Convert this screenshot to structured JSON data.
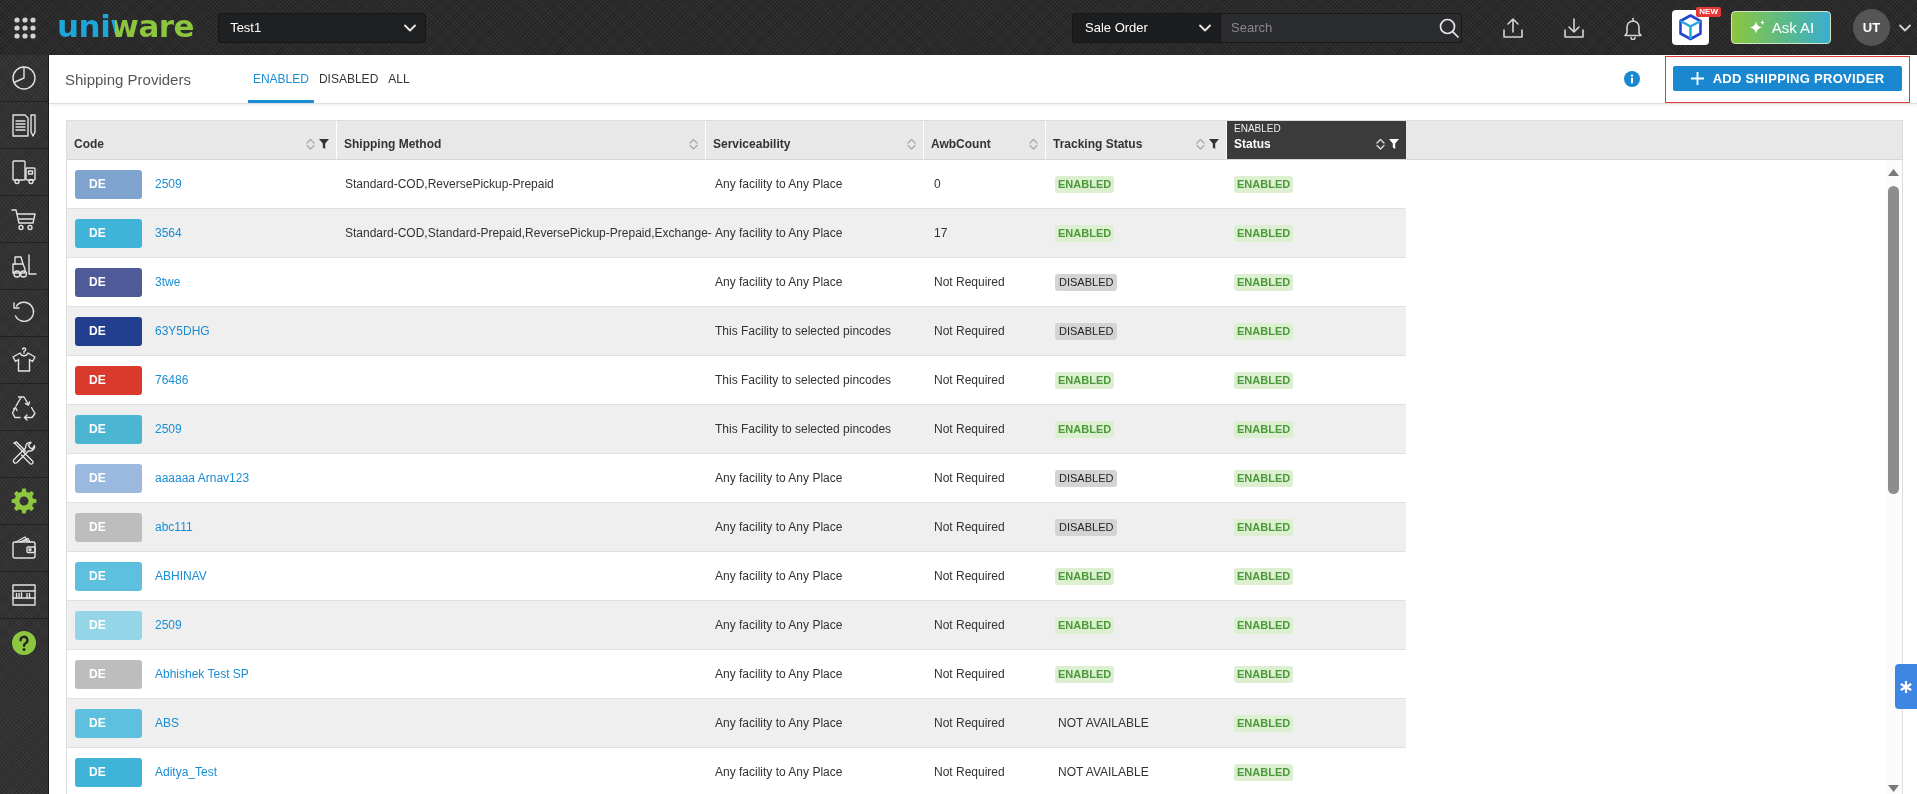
{
  "top_bar": {
    "logo": "uniware",
    "facility": "Test1",
    "search_type": "Sale Order",
    "search": {
      "placeholder": "Search"
    },
    "new_badge": "NEW",
    "ask_ai": "Ask AI",
    "avatar": "UT"
  },
  "sidebar": {
    "items": [
      {
        "selected": false
      },
      {
        "selected": false
      },
      {
        "selected": false
      },
      {
        "selected": false
      },
      {
        "selected": false
      },
      {
        "selected": false
      },
      {
        "selected": false
      },
      {
        "selected": false
      },
      {
        "selected": false
      },
      {
        "selected": true
      },
      {
        "selected": false
      },
      {
        "selected": false
      }
    ]
  },
  "header": {
    "title": "Shipping Providers",
    "tabs": [
      {
        "label": "ENABLED",
        "selected": true
      },
      {
        "label": "DISABLED",
        "selected": false
      },
      {
        "label": "ALL",
        "selected": false
      }
    ],
    "add_button": {
      "label": "ADD SHIPPING PROVIDER",
      "highlighted": true
    }
  },
  "table": {
    "columns": [
      {
        "label": "Code",
        "sortable": true,
        "filter": true
      },
      {
        "label": "Shipping Method",
        "sortable": true,
        "filter": false
      },
      {
        "label": "Serviceability",
        "sortable": true,
        "filter": false
      },
      {
        "label": "AwbCount",
        "sortable": true,
        "filter": false
      },
      {
        "label": "Tracking Status",
        "sortable": true,
        "filter": true
      },
      {
        "label": "Status",
        "sortable": true,
        "filter": true,
        "filter_value": "ENABLED"
      }
    ],
    "rows": [
      {
        "badge": "DE",
        "color": "#7ea3cf",
        "code": "2509",
        "shipping_method": "Standard-COD,ReversePickup-Prepaid",
        "serviceability": "Any facility to Any Place",
        "awb_count": "0",
        "tracking_status": {
          "kind": "enabled",
          "label": "ENABLED"
        },
        "status": {
          "kind": "enabled",
          "label": "ENABLED"
        }
      },
      {
        "badge": "DE",
        "color": "#3fb4d8",
        "code": "3564",
        "shipping_method": "Standard-COD,Standard-Prepaid,ReversePickup-Prepaid,Exchange-",
        "serviceability": "Any facility to Any Place",
        "awb_count": "17",
        "tracking_status": {
          "kind": "enabled",
          "label": "ENABLED"
        },
        "status": {
          "kind": "enabled",
          "label": "ENABLED"
        }
      },
      {
        "badge": "DE",
        "color": "#4f5b99",
        "code": "3twe",
        "serviceability": "Any facility to Any Place",
        "awb_count": "Not Required",
        "tracking_status": {
          "kind": "disabled",
          "label": "DISABLED"
        },
        "status": {
          "kind": "enabled",
          "label": "ENABLED"
        }
      },
      {
        "badge": "DE",
        "color": "#213e8f",
        "code": "63Y5DHG",
        "serviceability": "This Facility to selected pincodes",
        "awb_count": "Not Required",
        "tracking_status": {
          "kind": "disabled",
          "label": "DISABLED"
        },
        "status": {
          "kind": "enabled",
          "label": "ENABLED"
        }
      },
      {
        "badge": "DE",
        "color": "#d93a2b",
        "code": "76486",
        "serviceability": "This Facility to selected pincodes",
        "awb_count": "Not Required",
        "tracking_status": {
          "kind": "enabled",
          "label": "ENABLED"
        },
        "status": {
          "kind": "enabled",
          "label": "ENABLED"
        }
      },
      {
        "badge": "DE",
        "color": "#4bb5d2",
        "code": "2509",
        "serviceability": "This Facility to selected pincodes",
        "awb_count": "Not Required",
        "tracking_status": {
          "kind": "enabled",
          "label": "ENABLED"
        },
        "status": {
          "kind": "enabled",
          "label": "ENABLED"
        }
      },
      {
        "badge": "DE",
        "color": "#9bb8de",
        "code": "aaaaaa Arnav123",
        "serviceability": "Any facility to Any Place",
        "awb_count": "Not Required",
        "tracking_status": {
          "kind": "disabled",
          "label": "DISABLED"
        },
        "status": {
          "kind": "enabled",
          "label": "ENABLED"
        }
      },
      {
        "badge": "DE",
        "color": "#bdbdbd",
        "code": "abc111",
        "serviceability": "Any facility to Any Place",
        "awb_count": "Not Required",
        "tracking_status": {
          "kind": "disabled",
          "label": "DISABLED"
        },
        "status": {
          "kind": "enabled",
          "label": "ENABLED"
        }
      },
      {
        "badge": "DE",
        "color": "#5ec0df",
        "code": "ABHINAV",
        "serviceability": "Any facility to Any Place",
        "awb_count": "Not Required",
        "tracking_status": {
          "kind": "enabled",
          "label": "ENABLED"
        },
        "status": {
          "kind": "enabled",
          "label": "ENABLED"
        }
      },
      {
        "badge": "DE",
        "color": "#94d5e8",
        "code": "2509",
        "serviceability": "Any facility to Any Place",
        "awb_count": "Not Required",
        "tracking_status": {
          "kind": "enabled",
          "label": "ENABLED"
        },
        "status": {
          "kind": "enabled",
          "label": "ENABLED"
        }
      },
      {
        "badge": "DE",
        "color": "#bdbdbd",
        "code": "Abhishek Test SP",
        "serviceability": "Any facility to Any Place",
        "awb_count": "Not Required",
        "tracking_status": {
          "kind": "enabled",
          "label": "ENABLED"
        },
        "status": {
          "kind": "enabled",
          "label": "ENABLED"
        }
      },
      {
        "badge": "DE",
        "color": "#5ec0df",
        "code": "ABS",
        "serviceability": "Any facility to Any Place",
        "awb_count": "Not Required",
        "tracking_status": {
          "kind": "plain",
          "label": "NOT AVAILABLE"
        },
        "status": {
          "kind": "enabled",
          "label": "ENABLED"
        }
      },
      {
        "badge": "DE",
        "color": "#3fb4d8",
        "code": "Aditya_Test",
        "serviceability": "Any facility to Any Place",
        "awb_count": "Not Required",
        "tracking_status": {
          "kind": "plain",
          "label": "NOT AVAILABLE"
        },
        "status": {
          "kind": "enabled",
          "label": "ENABLED"
        }
      }
    ]
  }
}
